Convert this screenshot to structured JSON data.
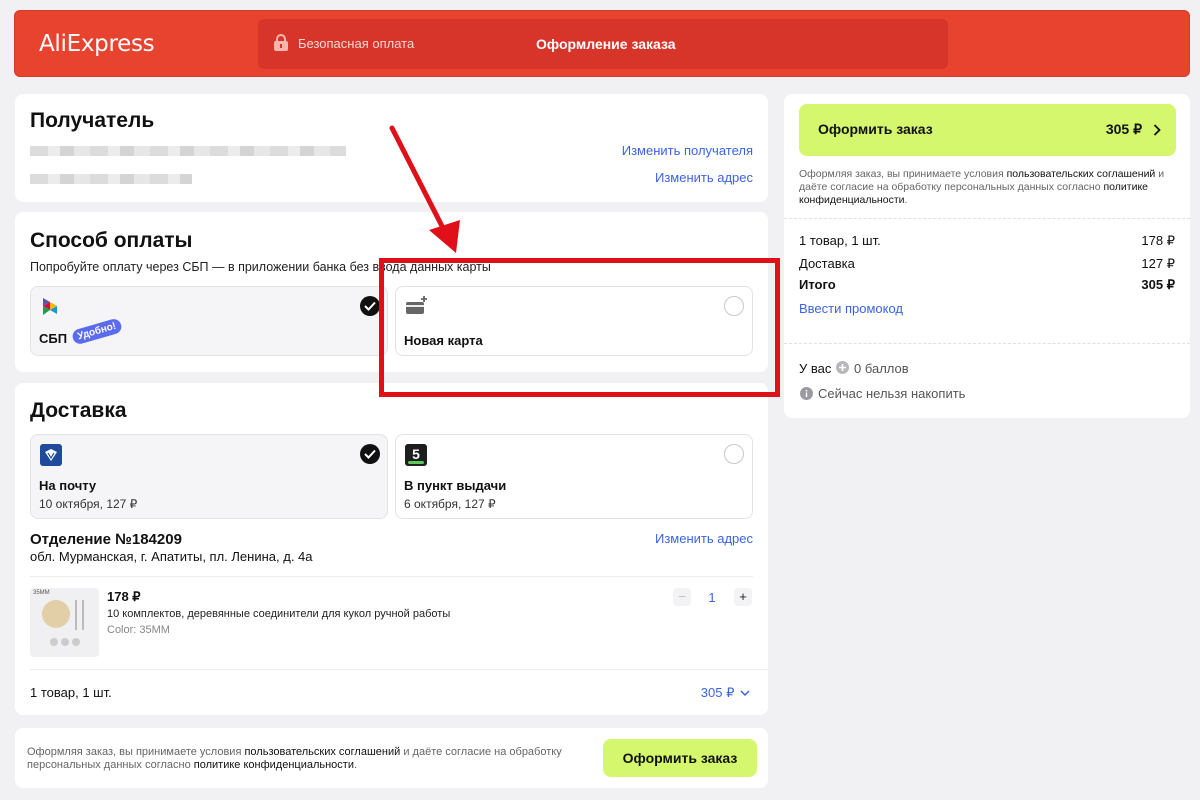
{
  "header": {
    "logo": "AliExpress",
    "secure_payment": "Безопасная оплата",
    "title": "Оформление заказа"
  },
  "recipient": {
    "heading": "Получатель",
    "change_recipient": "Изменить получателя",
    "change_address": "Изменить адрес"
  },
  "payment": {
    "heading": "Способ оплаты",
    "hint": "Попробуйте оплату через СБП — в приложении банка без ввода данных карты",
    "sbp_label": "СБП",
    "sbp_badge": "Удобно!",
    "new_card_label": "Новая карта"
  },
  "delivery": {
    "heading": "Доставка",
    "options": [
      {
        "title": "На почту",
        "sub": "10 октября, 127 ₽",
        "icon": "russian-post-icon",
        "selected": true
      },
      {
        "title": "В пункт выдачи",
        "sub": "6 октября, 127 ₽",
        "icon": "pickup-5-icon",
        "selected": false
      }
    ],
    "office_title": "Отделение №184209",
    "office_address": "обл. Мурманская, г. Апатиты, пл. Ленина, д. 4а",
    "change_address": "Изменить адрес"
  },
  "item": {
    "thumb_label": "35MM",
    "price": "178 ₽",
    "title": "10 комплектов, деревянные соединители для кукол ручной работы",
    "color": "Color: 35MM",
    "qty": "1",
    "minus": "−",
    "plus": "+"
  },
  "footer_summary": {
    "count": "1 товар, 1 шт.",
    "total": "305 ₽"
  },
  "bottom": {
    "agree_prefix": "Оформляя заказ, вы принимаете условия ",
    "agree_link1": "пользовательских соглашений",
    "agree_mid": " и даёте согласие на обработку персональных данных согласно ",
    "agree_link2": "политике конфиденциальности",
    "agree_end": ".",
    "button": "Оформить заказ"
  },
  "sidebar": {
    "button_label": "Оформить заказ",
    "button_total": "305 ₽",
    "agree_prefix": "Оформляя заказ, вы принимаете условия ",
    "agree_link1": "пользовательских соглашений",
    "agree_mid": " и даёте согласие на обработку персональных данных согласно ",
    "agree_link2": "политике конфиденциальности",
    "agree_end": ".",
    "rows": [
      {
        "label": "1 товар, 1 шт.",
        "value": "178 ₽"
      },
      {
        "label": "Доставка",
        "value": "127 ₽"
      },
      {
        "label": "Итого",
        "value": "305 ₽"
      }
    ],
    "promo": "Ввести промокод",
    "points_prefix": "У вас",
    "points_value": "0 баллов",
    "cannot_earn": "Сейчас нельзя накопить"
  },
  "colors": {
    "brand_red": "#e8432f",
    "accent_green": "#d5f76d",
    "link_blue": "#3b63e5",
    "annotation_red": "#e0101a"
  }
}
